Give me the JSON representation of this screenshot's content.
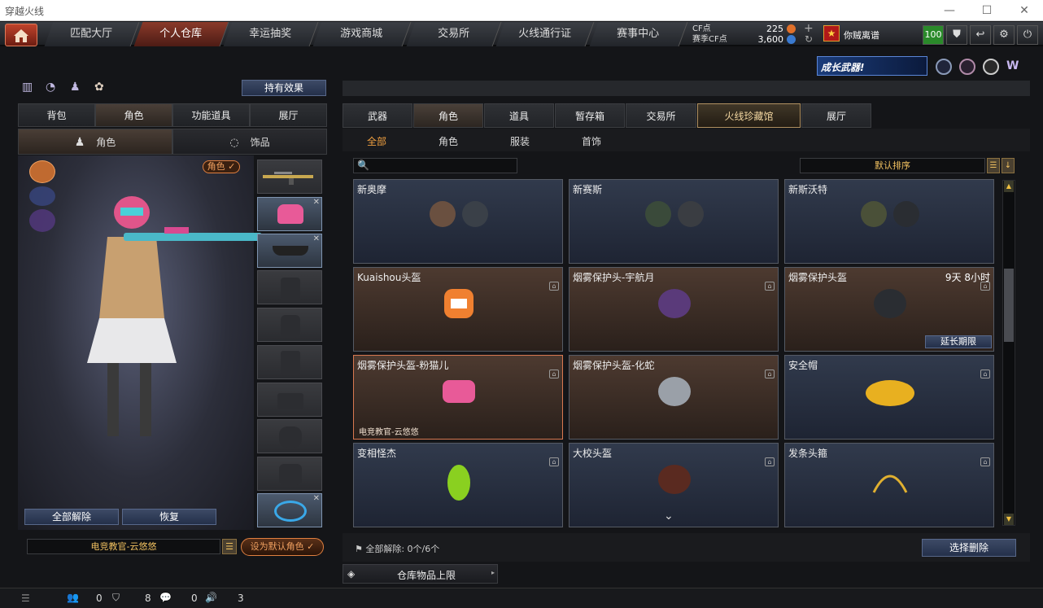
{
  "window": {
    "title": "穿越火线",
    "min": "—",
    "max": "☐",
    "close": "✕"
  },
  "nav": {
    "tabs": [
      "匹配大厅",
      "个人仓库",
      "幸运抽奖",
      "游戏商城",
      "交易所",
      "火线通行证",
      "赛事中心"
    ],
    "active": 1
  },
  "currency": {
    "cf_label": "CF点",
    "cf_value": "225",
    "match_label": "赛季CF点",
    "match_value": "3,600"
  },
  "user": {
    "name": "你贼离谱",
    "level_badge": "100"
  },
  "banner": {
    "text": "成长武器!"
  },
  "left": {
    "effect_button": "持有效果",
    "tabs": [
      "背包",
      "角色",
      "功能道具",
      "展厅"
    ],
    "active_tab": 1,
    "subtabs": [
      "角色",
      "饰品"
    ],
    "role_badge": "角色 ✓",
    "unequip_all": "全部解除",
    "restore": "恢复",
    "current_role": "电竞教官-云悠悠",
    "set_default": "设为默认角色"
  },
  "right": {
    "tabs": [
      "武器",
      "角色",
      "道具",
      "暂存箱",
      "交易所",
      "火线珍藏馆",
      "展厅"
    ],
    "active_tab": 1,
    "filters": [
      "全部",
      "角色",
      "服装",
      "首饰"
    ],
    "active_filter": 0,
    "search_placeholder": "",
    "sort_label": "默认排序",
    "cards": [
      {
        "name": "新奥摩",
        "style": "blue",
        "note": "",
        "extend": "",
        "footer": ""
      },
      {
        "name": "新赛斯",
        "style": "blue",
        "note": "",
        "extend": "",
        "footer": ""
      },
      {
        "name": "新斯沃特",
        "style": "blue",
        "note": "",
        "extend": "",
        "footer": ""
      },
      {
        "name": "Kuaishou头盔",
        "style": "brown",
        "note": "",
        "extend": "",
        "footer": ""
      },
      {
        "name": "烟雾保护头-宇航月",
        "style": "brown",
        "note": "",
        "extend": "",
        "footer": ""
      },
      {
        "name": "烟雾保护头盔",
        "style": "brown",
        "note": "9天 8小时",
        "extend": "延长期限",
        "footer": ""
      },
      {
        "name": "烟雾保护头盔-粉猫儿",
        "style": "brown",
        "note": "",
        "extend": "",
        "footer": "电竞教官-云悠悠"
      },
      {
        "name": "烟雾保护头盔-化蛇",
        "style": "brown",
        "note": "",
        "extend": "",
        "footer": ""
      },
      {
        "name": "安全帽",
        "style": "blue",
        "note": "",
        "extend": "",
        "footer": ""
      },
      {
        "name": "变相怪杰",
        "style": "blue",
        "note": "",
        "extend": "",
        "footer": ""
      },
      {
        "name": "大校头盔",
        "style": "blue",
        "note": "",
        "extend": "",
        "footer": ""
      },
      {
        "name": "发条头箍",
        "style": "blue",
        "note": "",
        "extend": "",
        "footer": ""
      }
    ],
    "unequip_count": "全部解除: 0个/6个",
    "select_delete": "选择删除",
    "storage_limit": "仓库物品上限"
  },
  "bottom": {
    "stat1": "0",
    "stat2": "8",
    "stat3": "0",
    "stat4": "3"
  },
  "colors": {
    "accent": "#c0432b",
    "gold": "#f0a040",
    "panel": "#1f2125"
  }
}
